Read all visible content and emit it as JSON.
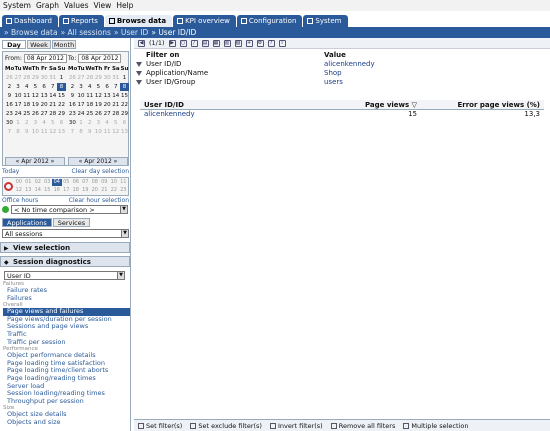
{
  "menubar": {
    "items": [
      "System",
      "Graph",
      "Values",
      "View",
      "Help"
    ]
  },
  "tabs": [
    {
      "label": "Dashboard",
      "active": false
    },
    {
      "label": "Reports",
      "active": false
    },
    {
      "label": "Browse data",
      "active": true
    },
    {
      "label": "KPI overview",
      "active": false
    },
    {
      "label": "Configuration",
      "active": false
    },
    {
      "label": "System",
      "active": false
    }
  ],
  "breadcrumb": [
    "» Browse data",
    "» All sessions",
    "» User ID",
    "» User ID/ID"
  ],
  "dayweek": [
    "Day",
    "Week",
    "Month"
  ],
  "calendar": {
    "from_label": "From:",
    "from_value": "08 Apr 2012",
    "to_label": "To:",
    "to_value": "08 Apr 2012",
    "days": [
      "Mo",
      "Tu",
      "We",
      "Th",
      "Fr",
      "Sa",
      "Su"
    ],
    "left_weeks": [
      [
        "26",
        "27",
        "28",
        "29",
        "30",
        "31",
        "1"
      ],
      [
        "2",
        "3",
        "4",
        "5",
        "6",
        "7",
        "8"
      ],
      [
        "9",
        "10",
        "11",
        "12",
        "13",
        "14",
        "15"
      ],
      [
        "16",
        "17",
        "18",
        "19",
        "20",
        "21",
        "22"
      ],
      [
        "23",
        "24",
        "25",
        "26",
        "27",
        "28",
        "29"
      ],
      [
        "30",
        "1",
        "2",
        "3",
        "4",
        "5",
        "6"
      ],
      [
        "7",
        "8",
        "9",
        "10",
        "11",
        "12",
        "13"
      ]
    ],
    "right_weeks": [
      [
        "26",
        "27",
        "28",
        "29",
        "30",
        "31",
        "1"
      ],
      [
        "2",
        "3",
        "4",
        "5",
        "6",
        "7",
        "8"
      ],
      [
        "9",
        "10",
        "11",
        "12",
        "13",
        "14",
        "15"
      ],
      [
        "16",
        "17",
        "18",
        "19",
        "20",
        "21",
        "22"
      ],
      [
        "23",
        "24",
        "25",
        "26",
        "27",
        "28",
        "29"
      ],
      [
        "30",
        "1",
        "2",
        "3",
        "4",
        "5",
        "6"
      ],
      [
        "7",
        "8",
        "9",
        "10",
        "11",
        "12",
        "13"
      ]
    ],
    "left_nav": "« Apr 2012 »",
    "right_nav": "« Apr 2012 »",
    "today": "Today",
    "clear_day": "Clear day selection"
  },
  "hours": {
    "row1": [
      "00",
      "01",
      "02",
      "03",
      "04",
      "05",
      "06",
      "07",
      "08",
      "09",
      "10",
      "11"
    ],
    "row2": [
      "12",
      "13",
      "14",
      "15",
      "16",
      "17",
      "18",
      "19",
      "20",
      "21",
      "22",
      "23"
    ],
    "selected": "04",
    "office_hours": "Office hours",
    "clear_hour": "Clear hour selection"
  },
  "comparison": {
    "value": "< No time comparison >"
  },
  "app_tabs": [
    {
      "label": "Applications",
      "active": true
    },
    {
      "label": "Services",
      "active": false
    }
  ],
  "all_sessions": "All sessions",
  "view_selection": "View selection",
  "session_diagnostics": "Session diagnostics",
  "user_id_select": "User ID",
  "analysis": [
    {
      "group": "Failures",
      "items": [
        "Failure rates",
        "Failures"
      ]
    },
    {
      "group": "Overall",
      "items": [
        "Page views and failures",
        "Page views/duration per session",
        "Sessions and page views",
        "Traffic",
        "Traffic per session"
      ]
    },
    {
      "group": "Performance",
      "items": [
        "Object performance details",
        "Page loading time satisfaction",
        "Page loading time/client aborts",
        "Page loading/reading times",
        "Server load",
        "Session loading/reading times",
        "Throughput per session"
      ]
    },
    {
      "group": "Size",
      "items": [
        "Object size details",
        "Objects and size"
      ]
    }
  ],
  "active_item": "Page views and failures",
  "toolbar": {
    "paging": "(1/1)"
  },
  "filters": {
    "header_col1": "Filter on",
    "header_col2": "Value",
    "rows": [
      {
        "field": "User ID/ID",
        "value": "alicenkennedy"
      },
      {
        "field": "Application/Name",
        "value": "Shop"
      },
      {
        "field": "User ID/Group",
        "value": "users"
      }
    ]
  },
  "table": {
    "col1": "User ID/ID",
    "col2": "Page views",
    "col3": "Error page views (%)",
    "rows": [
      {
        "id": "alicenkennedy",
        "page_views": "15",
        "error_pct": "13,3"
      }
    ]
  },
  "footer": [
    "Set filter(s)",
    "Set exclude filter(s)",
    "Invert filter(s)",
    "Remove all filters",
    "Multiple selection"
  ]
}
